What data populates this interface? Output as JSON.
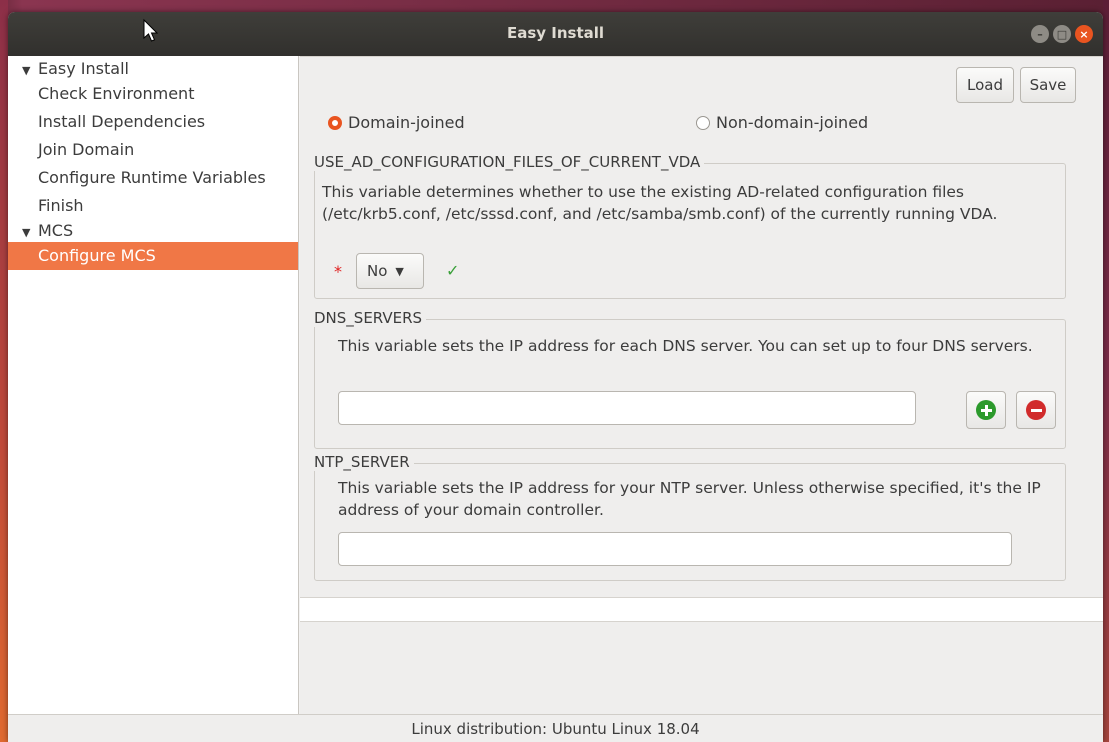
{
  "window": {
    "title": "Easy Install"
  },
  "sidebar": {
    "groups": [
      {
        "label": "Easy Install",
        "items": [
          "Check Environment",
          "Install Dependencies",
          "Join Domain",
          "Configure Runtime Variables",
          "Finish"
        ]
      },
      {
        "label": "MCS",
        "items": [
          "Configure MCS"
        ]
      }
    ],
    "selected": "Configure MCS"
  },
  "toolbar": {
    "load_label": "Load",
    "save_label": "Save"
  },
  "join_mode": {
    "options": [
      "Domain-joined",
      "Non-domain-joined"
    ],
    "selected": "Domain-joined"
  },
  "sections": {
    "ad_config": {
      "label": "USE_AD_CONFIGURATION_FILES_OF_CURRENT_VDA",
      "description": "This variable determines whether to use the existing AD-related configuration files (/etc/krb5.conf, /etc/sssd.conf, and /etc/samba/smb.conf) of the currently running VDA.",
      "required_mark": "*",
      "value": "No",
      "valid_mark": "✓"
    },
    "dns_servers": {
      "label": "DNS_SERVERS",
      "description": "This variable sets the IP address for each DNS server. You can set up to four DNS servers.",
      "value": ""
    },
    "ntp_server": {
      "label": "NTP_SERVER",
      "description": "This variable sets the IP address for your NTP server. Unless otherwise specified, it's the IP address of your domain controller.",
      "value": ""
    }
  },
  "status": {
    "text": "Linux distribution: Ubuntu Linux 18.04"
  },
  "colors": {
    "accent": "#e95420",
    "selection": "#f07746",
    "add": "#2c9a2c",
    "remove": "#d12b2b"
  }
}
